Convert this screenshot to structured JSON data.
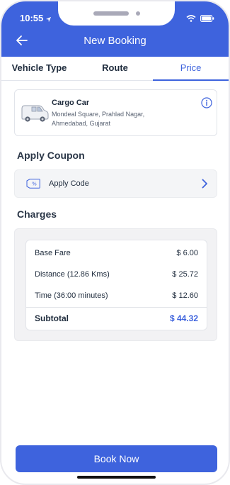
{
  "status_bar": {
    "time": "10:55"
  },
  "header": {
    "title": "New Booking",
    "back_icon": "arrow-left-icon"
  },
  "tabs": [
    {
      "label": "Vehicle Type",
      "active": false
    },
    {
      "label": "Route",
      "active": false
    },
    {
      "label": "Price",
      "active": true
    }
  ],
  "vehicle": {
    "name": "Cargo Car",
    "address": "Mondeal Square, Prahlad Nagar, Ahmedabad, Gujarat",
    "icon": "van-icon",
    "info_icon": "info-icon"
  },
  "coupon": {
    "section_title": "Apply Coupon",
    "label": "Apply Code",
    "icon": "discount-tag-icon",
    "chevron_icon": "chevron-right-icon"
  },
  "charges": {
    "section_title": "Charges",
    "items": [
      {
        "label": "Base Fare",
        "value": "$ 6.00"
      },
      {
        "label": "Distance (12.86 Kms)",
        "value": "$ 25.72"
      },
      {
        "label": "Time (36:00 minutes)",
        "value": "$ 12.60"
      }
    ],
    "subtotal_label": "Subtotal",
    "subtotal_value": "$ 44.32"
  },
  "action": {
    "book_label": "Book Now"
  },
  "colors": {
    "primary": "#3e63dd",
    "text": "#1e2b3c"
  }
}
